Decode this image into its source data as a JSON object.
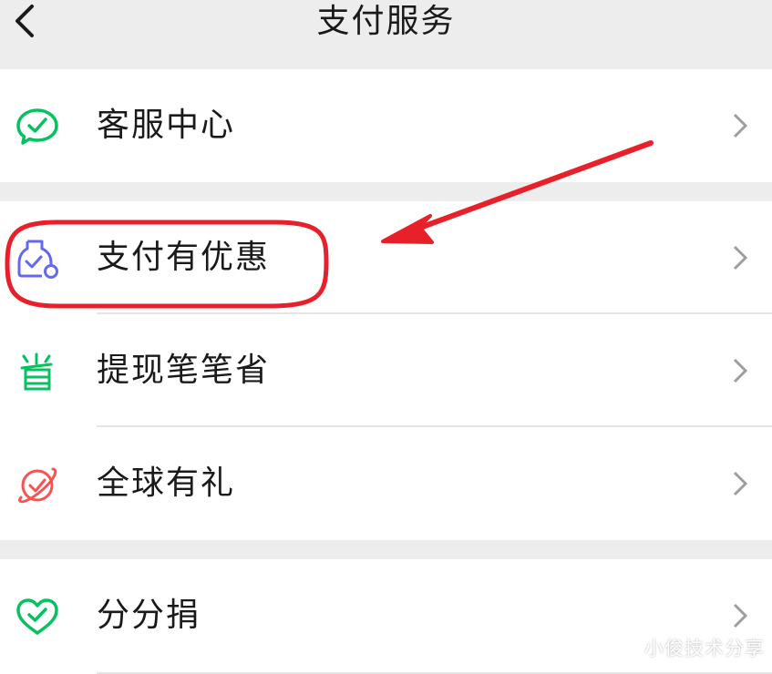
{
  "header": {
    "title": "支付服务",
    "back_icon": "chevron-left-icon"
  },
  "groups": [
    {
      "items": [
        {
          "label": "客服中心",
          "icon": "customer-service-icon",
          "icon_color": "#07c160"
        }
      ]
    },
    {
      "items": [
        {
          "label": "支付有优惠",
          "icon": "coupon-bag-icon",
          "icon_color": "#6467f0"
        },
        {
          "label": "提现笔笔省",
          "icon": "save-icon",
          "icon_color": "#07c160"
        },
        {
          "label": "全球有礼",
          "icon": "global-gift-icon",
          "icon_color": "#fa5151"
        }
      ]
    },
    {
      "items": [
        {
          "label": "分分捐",
          "icon": "heart-donate-icon",
          "icon_color": "#07c160"
        }
      ]
    }
  ],
  "annotations": {
    "highlight_color": "#e8202a",
    "highlighted_item": "支付有优惠"
  },
  "watermark": "小俊技术分享"
}
